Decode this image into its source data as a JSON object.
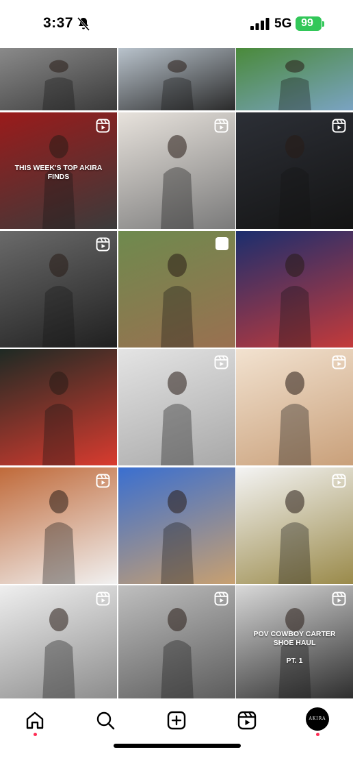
{
  "status_bar": {
    "time": "3:37",
    "network": "5G",
    "battery": "99"
  },
  "grid": {
    "tiles": [
      {
        "row": 0,
        "col": 0,
        "bg": [
          "#8a8a8a",
          "#3a3a3a"
        ],
        "icon": "none",
        "caption": ""
      },
      {
        "row": 0,
        "col": 1,
        "bg": [
          "#b9c3cc",
          "#2a2a2a"
        ],
        "icon": "none",
        "caption": ""
      },
      {
        "row": 0,
        "col": 2,
        "bg": [
          "#4a8a3a",
          "#7aa3c2"
        ],
        "icon": "none",
        "caption": ""
      },
      {
        "row": 1,
        "col": 0,
        "bg": [
          "#9a1b1b",
          "#3b3b3b"
        ],
        "icon": "reel-icon",
        "caption": "THIS WEEK'S TOP AKIRA FINDS"
      },
      {
        "row": 1,
        "col": 1,
        "bg": [
          "#e7e2dc",
          "#7a7a7a"
        ],
        "icon": "reel-icon",
        "caption": ""
      },
      {
        "row": 1,
        "col": 2,
        "bg": [
          "#2c2f36",
          "#141414"
        ],
        "icon": "reel-icon",
        "caption": ""
      },
      {
        "row": 2,
        "col": 0,
        "bg": [
          "#6a6a6a",
          "#202020"
        ],
        "icon": "reel-icon",
        "caption": ""
      },
      {
        "row": 2,
        "col": 1,
        "bg": [
          "#6e8a4e",
          "#9a7050"
        ],
        "icon": "square-icon",
        "caption": ""
      },
      {
        "row": 2,
        "col": 2,
        "bg": [
          "#1b2e6e",
          "#c43a3a"
        ],
        "icon": "none",
        "caption": ""
      },
      {
        "row": 3,
        "col": 0,
        "bg": [
          "#1e2a24",
          "#d93b2f"
        ],
        "icon": "none",
        "caption": ""
      },
      {
        "row": 3,
        "col": 1,
        "bg": [
          "#e4e4e4",
          "#a8a8a8"
        ],
        "icon": "reel-icon",
        "caption": ""
      },
      {
        "row": 3,
        "col": 2,
        "bg": [
          "#f2e2d0",
          "#c9a07a"
        ],
        "icon": "reel-icon",
        "caption": ""
      },
      {
        "row": 4,
        "col": 0,
        "bg": [
          "#c06a3a",
          "#f1f1f1"
        ],
        "icon": "reel-icon",
        "caption": ""
      },
      {
        "row": 4,
        "col": 1,
        "bg": [
          "#3a6fd0",
          "#c8a070"
        ],
        "icon": "none",
        "caption": ""
      },
      {
        "row": 4,
        "col": 2,
        "bg": [
          "#f4f4f4",
          "#9a8a4a"
        ],
        "icon": "reel-icon",
        "caption": ""
      },
      {
        "row": 5,
        "col": 0,
        "bg": [
          "#efefef",
          "#8a8a8a"
        ],
        "icon": "reel-icon",
        "caption": ""
      },
      {
        "row": 5,
        "col": 1,
        "bg": [
          "#bfbfbf",
          "#5a5a5a"
        ],
        "icon": "reel-icon",
        "caption": ""
      },
      {
        "row": 5,
        "col": 2,
        "bg": [
          "#d9d9d9",
          "#2a2a2a"
        ],
        "icon": "reel-icon",
        "caption": "POV COWBOY CARTER SHOE HAUL\n\nPT. 1"
      }
    ]
  },
  "bottom_nav": {
    "items": [
      "home-icon",
      "search-icon",
      "create-post-icon",
      "reels-icon",
      "profile-avatar"
    ],
    "profile_label": "AKIRA"
  }
}
